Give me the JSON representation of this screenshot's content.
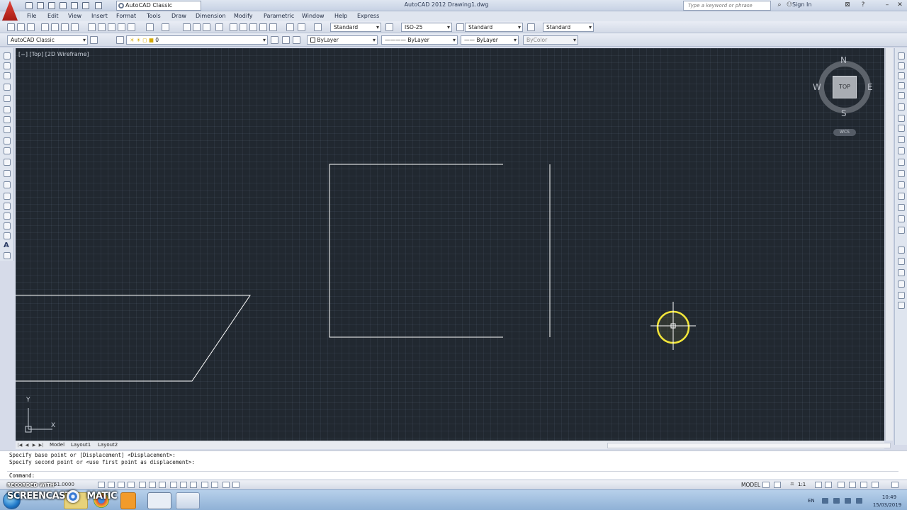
{
  "window": {
    "title": "AutoCAD 2012    Drawing1.dwg",
    "workspace": "AutoCAD Classic",
    "search_placeholder": "Type a keyword or phrase",
    "sign_in": "Sign In"
  },
  "menu": [
    "File",
    "Edit",
    "View",
    "Insert",
    "Format",
    "Tools",
    "Draw",
    "Dimension",
    "Modify",
    "Parametric",
    "Window",
    "Help",
    "Express"
  ],
  "styles_toolbar": {
    "text_style": "Standard",
    "dim_style": "ISO-25",
    "table_style": "Standard",
    "multileader_style": "Standard"
  },
  "layers_toolbar": {
    "workspace": "AutoCAD Classic",
    "layer": "0",
    "color": "ByLayer",
    "linetype": "ByLayer",
    "lineweight": "ByLayer",
    "plot_style": "ByColor"
  },
  "viewport": {
    "label": "[−] [Top] [2D Wireframe]",
    "compass": {
      "n": "N",
      "s": "S",
      "e": "E",
      "w": "W"
    },
    "cube_face": "TOP",
    "ucs_menu": "WCS",
    "ucs_x": "X",
    "ucs_y": "Y",
    "background": "#212830",
    "line_color": "#ffffff",
    "cursor_color": "#f2e53a"
  },
  "tabs": [
    "Model",
    "Layout1",
    "Layout2"
  ],
  "command": {
    "history": [
      "Specify base point or [Displacement] <Displacement>:",
      "Specify second point or <use first point as displacement>:"
    ],
    "prompt": "Command:"
  },
  "statusbar": {
    "coords": "51.0000",
    "model": "MODEL",
    "scale": "1:1"
  },
  "watermark": {
    "recorded": "RECORDED WITH",
    "brand": "SCREENCAST",
    "brand_suffix": "MATIC"
  },
  "taskbar": {
    "lang": "EN",
    "time": "10:49",
    "date": "15/03/2019"
  }
}
